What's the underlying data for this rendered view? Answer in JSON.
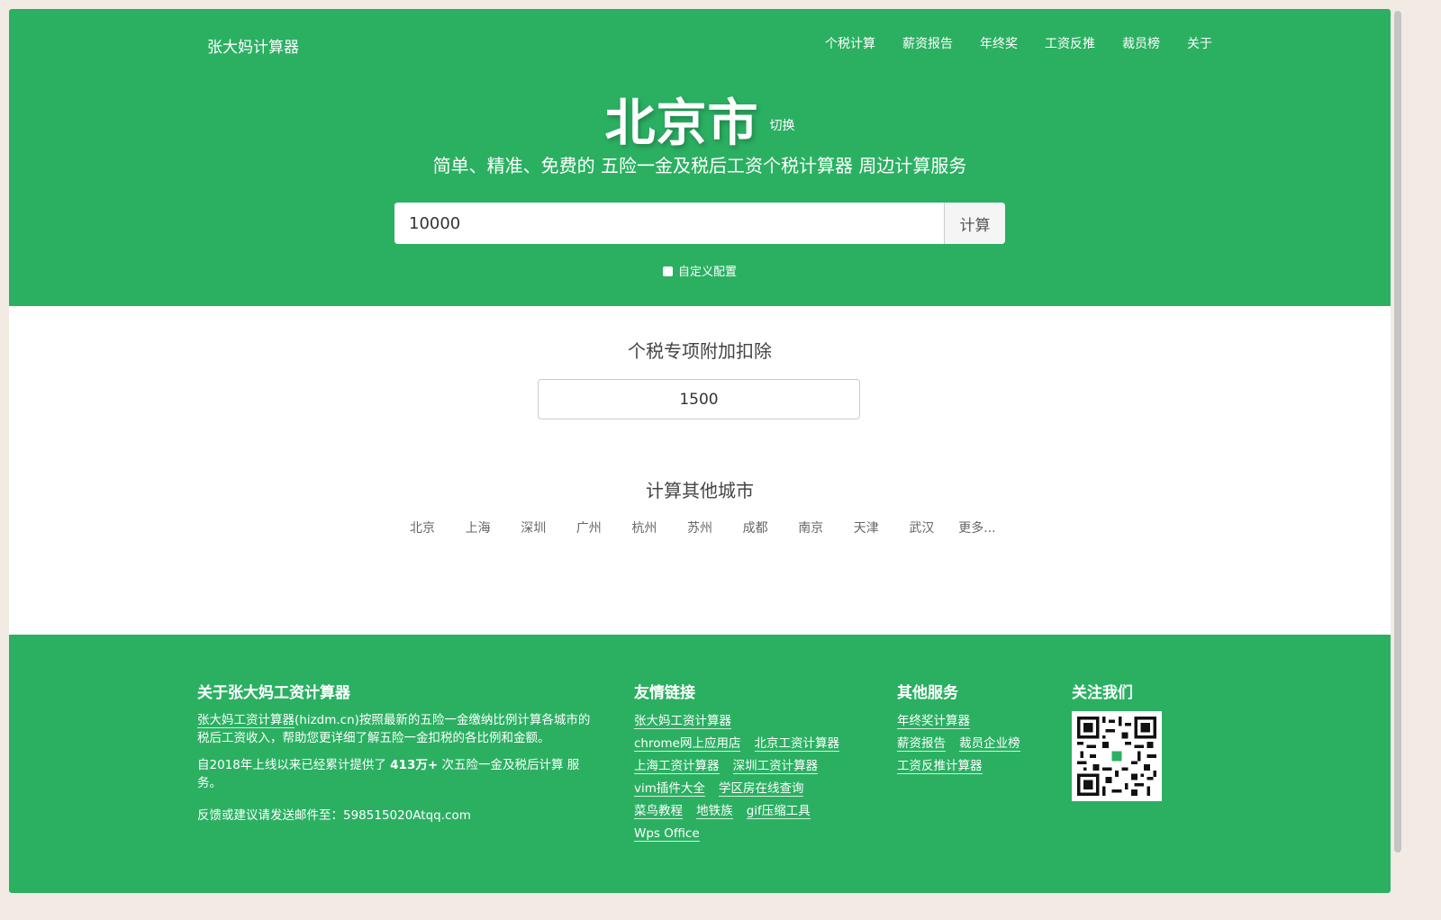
{
  "header": {
    "brand": "张大妈计算器",
    "nav": [
      "个税计算",
      "薪资报告",
      "年终奖",
      "工资反推",
      "裁员榜",
      "关于"
    ]
  },
  "hero": {
    "city": "北京市",
    "switch_label": "切换",
    "subtitle": "简单、精准、免费的 五险一金及税后工资个税计算器 周边计算服务",
    "salary_value": "10000",
    "calc_label": "计算",
    "custom_config_label": "自定义配置"
  },
  "deduction": {
    "title": "个税专项附加扣除",
    "value": "1500"
  },
  "other_cities": {
    "title": "计算其他城市",
    "items": [
      "北京",
      "上海",
      "深圳",
      "广州",
      "杭州",
      "苏州",
      "成都",
      "南京",
      "天津",
      "武汉",
      "更多..."
    ]
  },
  "footer": {
    "about": {
      "title": "关于张大妈工资计算器",
      "line1_link": "张大妈工资计算器",
      "line1_rest": "(hizdm.cn)按照最新的五险一金缴纳比例计算各城市的税后工资收入，帮助您更详细了解五险一金扣税的各比例和金额。",
      "line2_pre": "自2018年上线以来已经累计提供了 ",
      "line2_count": "413万+",
      "line2_post": " 次五险一金及税后计算 服务。",
      "line3": "反馈或建议请发送邮件至：598515020Atqq.com"
    },
    "links": {
      "title": "友情链接",
      "rows": [
        [
          "张大妈工资计算器"
        ],
        [
          "chrome网上应用店",
          "北京工资计算器"
        ],
        [
          "上海工资计算器",
          "深圳工资计算器"
        ],
        [
          "vim插件大全",
          "学区房在线查询"
        ],
        [
          "菜鸟教程",
          "地铁族",
          "gif压缩工具"
        ],
        [
          "Wps Office"
        ]
      ]
    },
    "services": {
      "title": "其他服务",
      "rows": [
        [
          "年终奖计算器"
        ],
        [
          "薪资报告",
          "裁员企业榜"
        ],
        [
          "工资反推计算器"
        ]
      ]
    },
    "follow": {
      "title": "关注我们"
    }
  },
  "colors": {
    "brand_green": "#2bb062"
  }
}
